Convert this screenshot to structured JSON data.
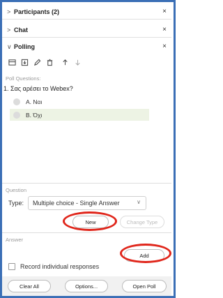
{
  "sections": {
    "participants": {
      "label": "Participants (2)",
      "close": "×",
      "chevron": ">"
    },
    "chat": {
      "label": "Chat",
      "close": "×",
      "chevron": ">"
    },
    "polling": {
      "label": "Polling",
      "close": "×",
      "chevron": "∨"
    }
  },
  "toolbar": {
    "icons": [
      "open-file-icon",
      "save-icon",
      "edit-icon",
      "delete-icon",
      "move-up-icon",
      "move-down-icon"
    ]
  },
  "poll": {
    "label": "Poll Questions:",
    "question": "1. Σας αρέσει το Webex?",
    "options": [
      {
        "label": "A.  Ναι"
      },
      {
        "label": "B.  Όχι"
      }
    ]
  },
  "question_section": {
    "label": "Question",
    "type_label": "Type:",
    "type_value": "Multiple choice - Single Answer",
    "new_label": "New",
    "change_type_label": "Change Type"
  },
  "answer_section": {
    "label": "Answer",
    "add_label": "Add",
    "record_label": "Record individual responses"
  },
  "footer": {
    "clear_all": "Clear All",
    "options": "Options...",
    "open_poll": "Open Poll"
  },
  "colors": {
    "frame_border": "#3b6fb6",
    "annotation_ring": "#e0261b",
    "selected_option_bg": "#edf3e4"
  }
}
